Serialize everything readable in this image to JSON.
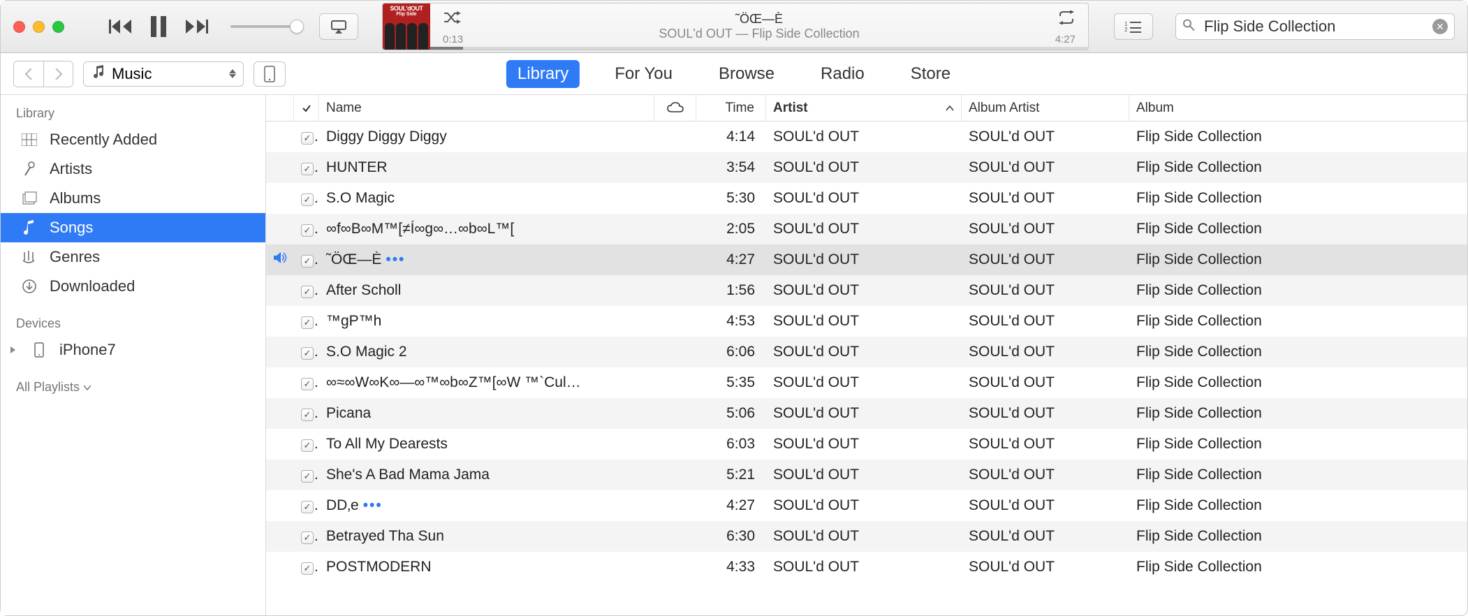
{
  "player": {
    "track_title": "˜ÖŒ—È",
    "track_sub": "SOUL'd OUT — Flip Side Collection",
    "elapsed": "0:13",
    "remaining": "4:27",
    "art_title": "SOUL'dOUT",
    "art_sub": "Flip Side"
  },
  "search": {
    "value": "Flip Side Collection"
  },
  "media_picker": {
    "label": "Music"
  },
  "tabs": {
    "library": "Library",
    "for_you": "For You",
    "browse": "Browse",
    "radio": "Radio",
    "store": "Store"
  },
  "sidebar": {
    "library_heading": "Library",
    "devices_heading": "Devices",
    "playlists_heading": "All Playlists",
    "items": [
      {
        "label": "Recently Added"
      },
      {
        "label": "Artists"
      },
      {
        "label": "Albums"
      },
      {
        "label": "Songs"
      },
      {
        "label": "Genres"
      },
      {
        "label": "Downloaded"
      }
    ],
    "device": "iPhone7"
  },
  "columns": {
    "name": "Name",
    "time": "Time",
    "artist": "Artist",
    "album_artist": "Album Artist",
    "album": "Album"
  },
  "tracks": [
    {
      "name": "Diggy Diggy Diggy",
      "time": "4:14",
      "artist": "SOUL'd OUT",
      "album_artist": "SOUL'd OUT",
      "album": "Flip Side Collection"
    },
    {
      "name": "HUNTER",
      "time": "3:54",
      "artist": "SOUL'd OUT",
      "album_artist": "SOUL'd OUT",
      "album": "Flip Side Collection"
    },
    {
      "name": "S.O Magic",
      "time": "5:30",
      "artist": "SOUL'd OUT",
      "album_artist": "SOUL'd OUT",
      "album": "Flip Side Collection"
    },
    {
      "name": "∞f∞B∞M™[≠Í∞g∞…∞b∞L™[",
      "time": "2:05",
      "artist": "SOUL'd OUT",
      "album_artist": "SOUL'd OUT",
      "album": "Flip Side Collection"
    },
    {
      "name": "˜ÖŒ—È",
      "time": "4:27",
      "artist": "SOUL'd OUT",
      "album_artist": "SOUL'd OUT",
      "album": "Flip Side Collection",
      "playing": true,
      "more": true
    },
    {
      "name": "After Scholl",
      "time": "1:56",
      "artist": "SOUL'd OUT",
      "album_artist": "SOUL'd OUT",
      "album": "Flip Side Collection"
    },
    {
      "name": "™gP™h",
      "time": "4:53",
      "artist": "SOUL'd OUT",
      "album_artist": "SOUL'd OUT",
      "album": "Flip Side Collection"
    },
    {
      "name": "S.O Magic 2",
      "time": "6:06",
      "artist": "SOUL'd OUT",
      "album_artist": "SOUL'd OUT",
      "album": "Flip Side Collection"
    },
    {
      "name": "∞≈∞W∞K∞—∞™∞b∞Z™[∞W ™`Cul…",
      "time": "5:35",
      "artist": "SOUL'd OUT",
      "album_artist": "SOUL'd OUT",
      "album": "Flip Side Collection"
    },
    {
      "name": "Picana",
      "time": "5:06",
      "artist": "SOUL'd OUT",
      "album_artist": "SOUL'd OUT",
      "album": "Flip Side Collection"
    },
    {
      "name": "To All My Dearests",
      "time": "6:03",
      "artist": "SOUL'd OUT",
      "album_artist": "SOUL'd OUT",
      "album": "Flip Side Collection"
    },
    {
      "name": "She's A Bad Mama Jama",
      "time": "5:21",
      "artist": "SOUL'd OUT",
      "album_artist": "SOUL'd OUT",
      "album": "Flip Side Collection"
    },
    {
      "name": "DD‚e",
      "time": "4:27",
      "artist": "SOUL'd OUT",
      "album_artist": "SOUL'd OUT",
      "album": "Flip Side Collection",
      "more": true
    },
    {
      "name": "Betrayed Tha Sun",
      "time": "6:30",
      "artist": "SOUL'd OUT",
      "album_artist": "SOUL'd OUT",
      "album": "Flip Side Collection"
    },
    {
      "name": "POSTMODERN",
      "time": "4:33",
      "artist": "SOUL'd OUT",
      "album_artist": "SOUL'd OUT",
      "album": "Flip Side Collection"
    }
  ]
}
